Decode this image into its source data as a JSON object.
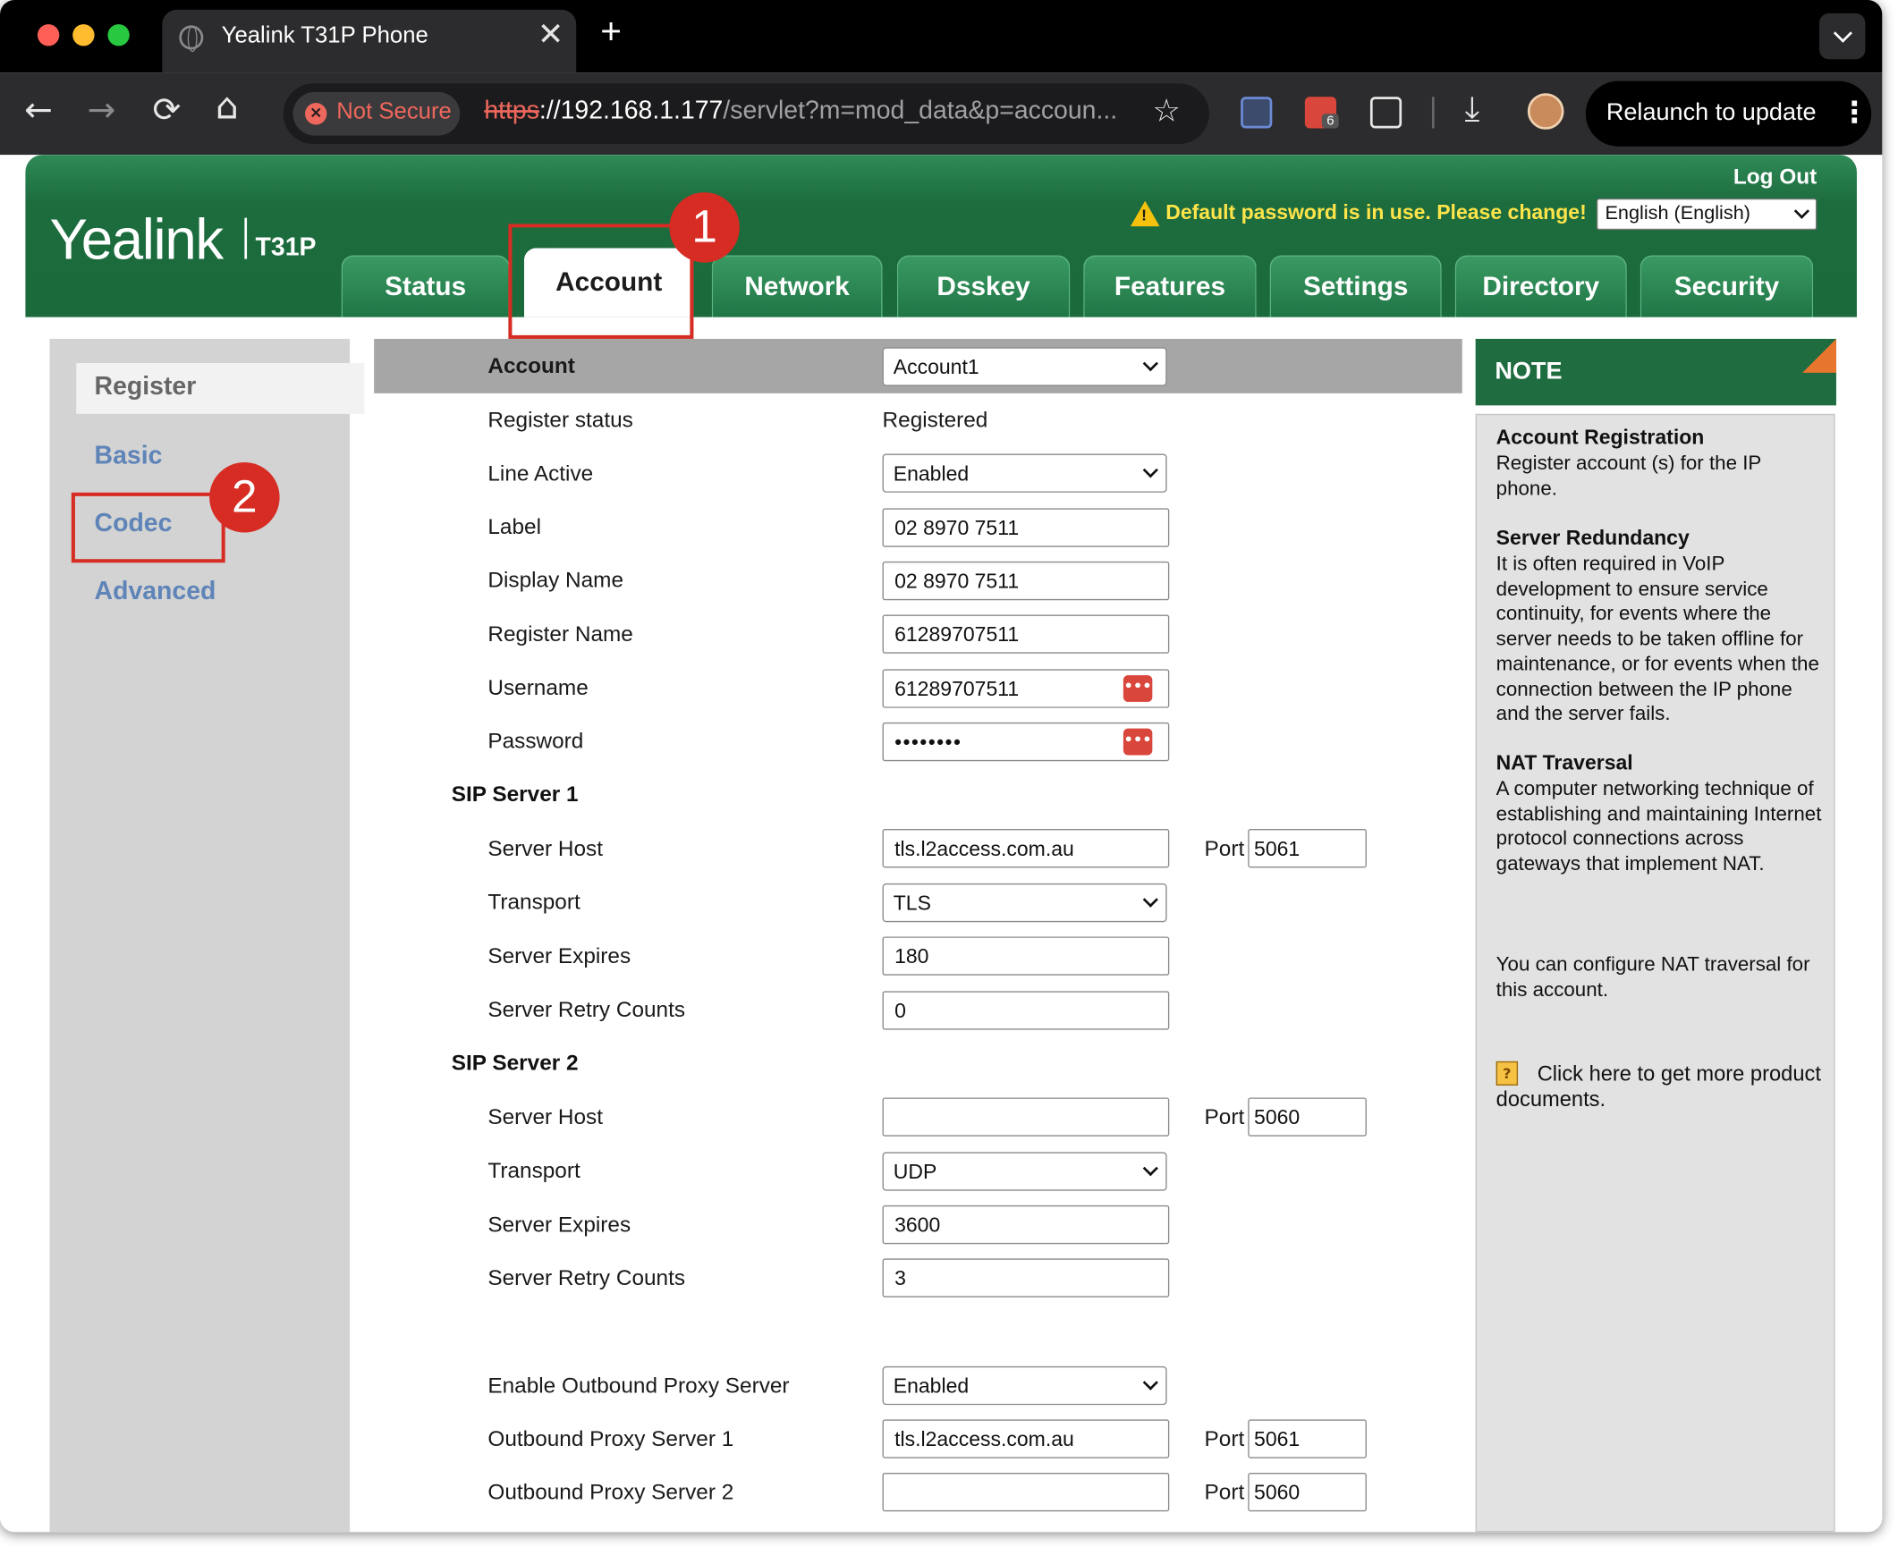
{
  "browser": {
    "tab_title": "Yealink T31P Phone",
    "new_tab": "+",
    "close_tab": "✕",
    "not_secure": "Not Secure",
    "url_scheme": "https",
    "url_host": "://192.168.1.177",
    "url_path": "/servlet?m=mod_data&p=accoun...",
    "extension_badge": "6",
    "relaunch": "Relaunch to update",
    "nav": {
      "back": "←",
      "forward": "→",
      "reload": "⟳",
      "home": "⌂",
      "star": "☆",
      "download": "⤓",
      "kebab": "⋮"
    }
  },
  "header": {
    "logo": "Yealink",
    "model": "T31P",
    "logout": "Log Out",
    "warning": "Default password is in use. Please change!",
    "language": "English (English)"
  },
  "tabs": [
    "Status",
    "Account",
    "Network",
    "Dsskey",
    "Features",
    "Settings",
    "Directory",
    "Security"
  ],
  "left_nav": {
    "register": "Register",
    "basic": "Basic",
    "codec": "Codec",
    "advanced": "Advanced"
  },
  "form": {
    "account": {
      "label": "Account",
      "value": "Account1"
    },
    "register_status": {
      "label": "Register status",
      "value": "Registered"
    },
    "line_active": {
      "label": "Line Active",
      "value": "Enabled"
    },
    "label": {
      "label": "Label",
      "value": "02 8970 7511"
    },
    "display_name": {
      "label": "Display Name",
      "value": "02 8970 7511"
    },
    "register_name": {
      "label": "Register Name",
      "value": "61289707511"
    },
    "username": {
      "label": "Username",
      "value": "61289707511"
    },
    "password": {
      "label": "Password",
      "value": "••••••••"
    },
    "sip1": {
      "title": "SIP Server 1",
      "host_label": "Server Host",
      "host": "tls.l2access.com.au",
      "port_label": "Port",
      "port": "5061",
      "transport_label": "Transport",
      "transport": "TLS",
      "expires_label": "Server Expires",
      "expires": "180",
      "retry_label": "Server Retry Counts",
      "retry": "0"
    },
    "sip2": {
      "title": "SIP Server 2",
      "host_label": "Server Host",
      "host": "",
      "port_label": "Port",
      "port": "5060",
      "transport_label": "Transport",
      "transport": "UDP",
      "expires_label": "Server Expires",
      "expires": "3600",
      "retry_label": "Server Retry Counts",
      "retry": "3"
    },
    "outbound_enable": {
      "label": "Enable Outbound Proxy Server",
      "value": "Enabled"
    },
    "outbound1": {
      "label": "Outbound Proxy Server 1",
      "value": "tls.l2access.com.au",
      "port_label": "Port",
      "port": "5061"
    },
    "outbound2": {
      "label": "Outbound Proxy Server 2",
      "value": "",
      "port_label": "Port",
      "port": "5060"
    }
  },
  "note": {
    "title": "NOTE",
    "h1": "Account Registration",
    "p1": "Register account (s) for the IP phone.",
    "h2": "Server Redundancy",
    "p2": "It is often required in VoIP development to ensure service continuity, for events where the server needs to be taken offline for maintenance, or for events when the connection between the IP phone and the server fails.",
    "h3": "NAT Traversal",
    "p3": "A computer networking technique of establishing and maintaining Internet protocol connections across gateways that implement NAT.",
    "p4": "You can configure NAT traversal for this account.",
    "link": "Click here to get more product documents."
  },
  "annotations": {
    "one": "1",
    "two": "2"
  },
  "colors": {
    "brand_green": "#1c6c3e",
    "callout_red": "#d62c24",
    "nav_link": "#5f84b8"
  }
}
